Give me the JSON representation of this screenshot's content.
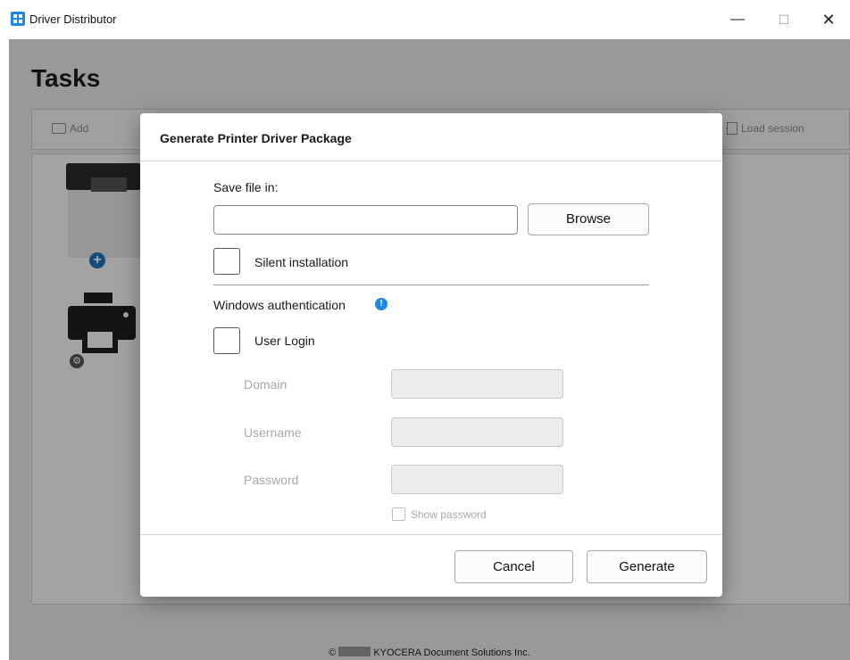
{
  "window": {
    "title": "Driver Distributor",
    "minimize_glyph": "—",
    "maximize_glyph": "☐",
    "close_glyph": "✕"
  },
  "main": {
    "heading": "Tasks",
    "toolbar": {
      "add_label": "Add",
      "load_session_label": "Load session"
    },
    "devices": [
      {
        "icon": "mfp-printer-icon",
        "badge": "+"
      },
      {
        "icon": "printer-icon",
        "badge": "⚙"
      }
    ],
    "footer": {
      "copyright_symbol": "©",
      "company": "KYOCERA Document Solutions Inc."
    }
  },
  "dialog": {
    "title": "Generate Printer Driver Package",
    "save_file_label": "Save file in:",
    "save_file_value": "",
    "browse_label": "Browse",
    "silent_install_label": "Silent installation",
    "silent_install_checked": false,
    "windows_auth_label": "Windows authentication",
    "info_glyph": "!",
    "user_login_label": "User Login",
    "user_login_checked": false,
    "domain_label": "Domain",
    "username_label": "Username",
    "password_label": "Password",
    "show_password_label": "Show password",
    "cancel_label": "Cancel",
    "generate_label": "Generate"
  },
  "colors": {
    "accent": "#1e88e5",
    "badge_blue": "#1e73be",
    "overlay": "rgba(0,0,0,0.35)"
  }
}
